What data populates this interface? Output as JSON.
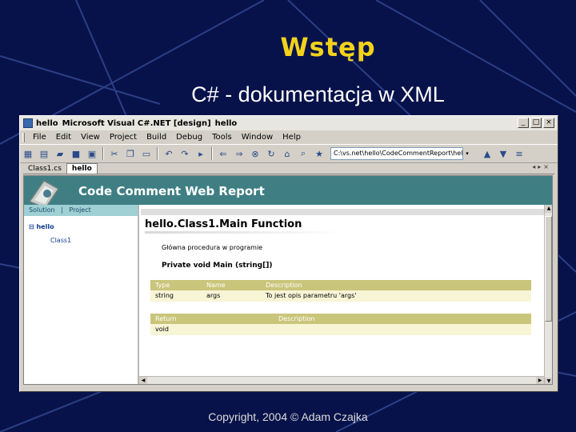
{
  "slide": {
    "title": "Wstęp",
    "subtitle": "C# - dokumentacja w XML",
    "footer": "Copyright, 2004 © Adam Czajka"
  },
  "window": {
    "title_project": "hello",
    "title_app": "Microsoft Visual C#.NET [design]",
    "title_doc": "hello",
    "buttons": {
      "minimize": "_",
      "maximize": "□",
      "close": "×"
    }
  },
  "menu": [
    "File",
    "Edit",
    "View",
    "Project",
    "Build",
    "Debug",
    "Tools",
    "Window",
    "Help"
  ],
  "toolbar": {
    "address": "C:\\vs.net\\hello\\CodeCommentReport\\hello",
    "address_dropdown": "▾"
  },
  "tabs": {
    "items": [
      "Class1.cs",
      "hello"
    ],
    "active": 1,
    "controls": "◂▸×"
  },
  "report": {
    "title": "Code Comment Web Report",
    "nav": {
      "solution": "Solution",
      "separator": "|",
      "project": "Project"
    },
    "tree": {
      "root": "⊟ hello",
      "child": "Class1"
    },
    "function_title": "hello.Class1.Main Function",
    "description": "Główna procedura w programie",
    "signature": "Private void Main (string[])",
    "params_table": {
      "headers": [
        "Type",
        "Name",
        "Description"
      ],
      "rows": [
        [
          "string",
          "args",
          "To jest opis parametru 'args'"
        ]
      ]
    },
    "returns_table": {
      "headers": [
        "Return",
        "Description"
      ],
      "rows": [
        [
          "void",
          ""
        ]
      ]
    }
  },
  "colors": {
    "slide_bg": "#08124a",
    "title_yellow": "#f2d21a",
    "report_header": "#3f7f84",
    "grid_header": "#c9c57a",
    "grid_row": "#f8f5d6"
  }
}
